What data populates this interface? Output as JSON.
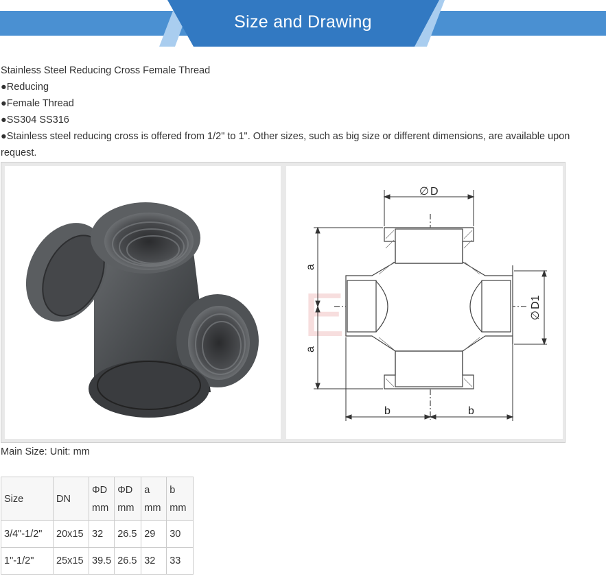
{
  "banner": {
    "title": "Size and Drawing",
    "colors": {
      "bar": "#4a90d2",
      "center": "#3279c2",
      "stripe_light": "#a9cdef"
    }
  },
  "description": {
    "title": "Stainless Steel Reducing Cross Female Thread",
    "bullets": [
      "●Reducing",
      "●Female Thread",
      "●SS304 SS316",
      "●Stainless steel reducing cross is offered from 1/2\" to 1\". Other sizes, such as big size or different dimensions, are available upon request."
    ]
  },
  "drawing": {
    "label_phi_d": "D",
    "label_phi_d1": "D1",
    "label_a_top": "a",
    "label_a_bottom": "a",
    "label_b_left": "b",
    "label_b_right": "b",
    "watermark": "EADEK"
  },
  "main_size": "Main Size:  Unit:  mm",
  "table": {
    "headers": [
      {
        "line1": "Size",
        "line2": ""
      },
      {
        "line1": "DN",
        "line2": ""
      },
      {
        "line1": "ΦD",
        "line2": "mm"
      },
      {
        "line1": "ΦD",
        "line2": "mm"
      },
      {
        "line1": "a",
        "line2": "mm"
      },
      {
        "line1": "b",
        "line2": "mm"
      }
    ],
    "rows": [
      [
        "3/4\"-1/2\"",
        "20x15",
        "32",
        "26.5",
        "29",
        "30"
      ],
      [
        "1\"-1/2\"",
        "25x15",
        "39.5",
        "26.5",
        "32",
        "33"
      ]
    ]
  }
}
